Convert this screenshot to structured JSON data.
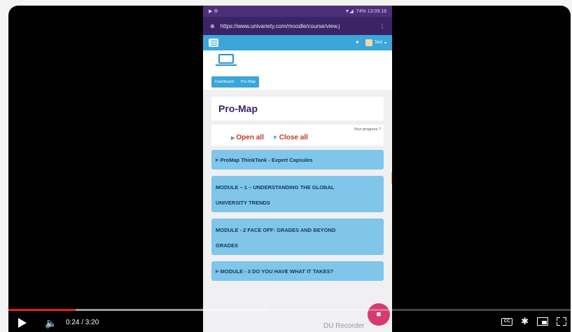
{
  "phone": {
    "status_time": "74% 13:09:18",
    "url": "https://www.univariety.com/moodle/course/view.j",
    "user_menu": "Test",
    "breadcrumb": [
      "Dashboard",
      "Pro-Map"
    ],
    "page_title": "Pro-Map",
    "progress_label": "Your progress",
    "open_all": "Open all",
    "close_all": "Close all",
    "modules": [
      "ProMap ThinkTank - Expert Capsules",
      "MODULE – 1 – UNDERSTANDING THE GLOBAL",
      "UNIVERSITY TRENDS",
      "MODULE - 2 FACE OFF: GRADES AND BEYOND",
      "GRADES",
      "MODULE - 3 DO YOU HAVE WHAT IT TAKES?"
    ],
    "recorder_label": "DU Recorder"
  },
  "player": {
    "current_time": "0:24",
    "duration": "3:20",
    "time_display": "0:24 / 3:20",
    "progress_fraction": 0.12,
    "loaded_fraction": 0.46,
    "accent_color": "#e62117",
    "cc_label": "CC"
  },
  "icons": [
    "play-icon",
    "volume-icon",
    "captions-icon",
    "gear-icon",
    "miniplayer-icon",
    "fullscreen-icon",
    "laptop-icon",
    "menu-icon",
    "record-icon"
  ]
}
